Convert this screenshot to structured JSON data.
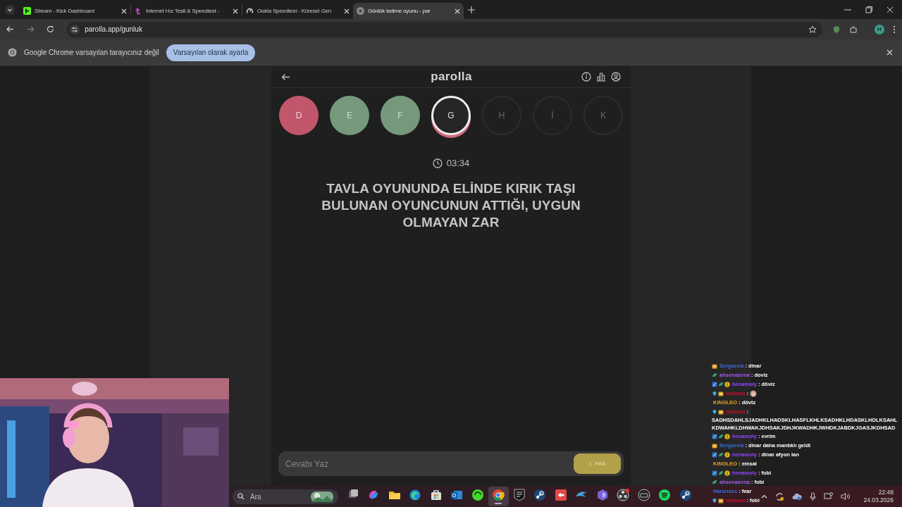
{
  "browser": {
    "tabs": [
      {
        "title": "Stream - Kick Dashboard",
        "selected": false,
        "kind": "square"
      },
      {
        "title": "İnternet Hız Testi & Speedtest -",
        "selected": false,
        "kind": "letter"
      },
      {
        "title": "Ookla Speedtest - Küresel Gen",
        "selected": false,
        "kind": "gauge"
      },
      {
        "title": "Günlük kelime oyunu - par",
        "selected": true,
        "kind": "circle"
      }
    ],
    "address": "parolla.app/gunluk",
    "profile_initial": "H",
    "infobar": {
      "message": "Google Chrome varsayılan tarayıcınız değil",
      "button": "Varsayılan olarak ayarla"
    }
  },
  "game": {
    "logo": "parolla",
    "letters": [
      {
        "letter": "D",
        "kind": "wrong"
      },
      {
        "letter": "E",
        "kind": "correct"
      },
      {
        "letter": "F",
        "kind": "correct"
      },
      {
        "letter": "G",
        "kind": "current"
      },
      {
        "letter": "H",
        "kind": "pending"
      },
      {
        "letter": "İ",
        "kind": "pending"
      },
      {
        "letter": "K",
        "kind": "pending"
      }
    ],
    "timer": "03:34",
    "question": "TAVLA OYUNUNDA ELİNDE KIRIK TAŞI BULUNAN OYUNCUNUN ATTIĞI, UYGUN OLMAYAN ZAR",
    "answer_placeholder": "Cevabı Yaz",
    "pass_button": "PAS"
  },
  "chat": [
    {
      "badges": [
        {
          "kind": "crown"
        }
      ],
      "user": "Sergoreis",
      "color": "#3b6fd8",
      "separator": ":",
      "text": "dinar",
      "kind": "text"
    },
    {
      "badges": [
        {
          "kind": "leaf"
        }
      ],
      "user": "ahsenasena",
      "color": "#a855f7",
      "separator": ":",
      "text": "doviz",
      "kind": "text"
    },
    {
      "badges": [
        {
          "kind": "box"
        },
        {
          "kind": "leaf"
        },
        {
          "kind": "coin"
        }
      ],
      "user": "henamoly",
      "color": "#9146ff",
      "separator": ":",
      "text": "döviz",
      "kind": "text"
    },
    {
      "badges": [
        {
          "kind": "gem"
        },
        {
          "kind": "crown"
        }
      ],
      "user": "tazkaan",
      "color": "#c8102e",
      "separator": ":",
      "kind": "emote"
    },
    {
      "user": "KINGLEO",
      "color": "#e8a020",
      "separator": ":",
      "text": "dövtz",
      "kind": "text"
    },
    {
      "badges": [
        {
          "kind": "gem"
        },
        {
          "kind": "crown"
        }
      ],
      "user": "tazkaan",
      "color": "#c8102e",
      "separator": ":",
      "text": "SADHSDAHLSJADHKLHADSKLHASFLKHLKSADHKLHDASKLHDLKSAHLKDWAHKLDHWAKJDHSAKJDHJKWADHKJWHDKJABDKJGASJKDHSAD",
      "kind": "long"
    },
    {
      "badges": [
        {
          "kind": "box"
        },
        {
          "kind": "leaf"
        },
        {
          "kind": "coin"
        }
      ],
      "user": "henamoly",
      "color": "#9146ff",
      "separator": ":",
      "text": "evrim",
      "kind": "text"
    },
    {
      "badges": [
        {
          "kind": "crown"
        }
      ],
      "user": "Sergoreis",
      "color": "#3b6fd8",
      "separator": ":",
      "text": "dinar daha mantıklı geldi",
      "kind": "text"
    },
    {
      "badges": [
        {
          "kind": "box"
        },
        {
          "kind": "leaf"
        },
        {
          "kind": "coin"
        }
      ],
      "user": "henamoly",
      "color": "#9146ff",
      "separator": ":",
      "text": "dinar afyon lan",
      "kind": "text"
    },
    {
      "user": "KINGLEO",
      "color": "#e8a020",
      "separator": ":",
      "text": "emsal",
      "kind": "text"
    },
    {
      "badges": [
        {
          "kind": "box"
        },
        {
          "kind": "leaf"
        },
        {
          "kind": "coin"
        }
      ],
      "user": "henamoly",
      "color": "#9146ff",
      "separator": ":",
      "text": "fobi",
      "kind": "text"
    },
    {
      "badges": [
        {
          "kind": "leaf"
        }
      ],
      "user": "ahsenasena",
      "color": "#a855f7",
      "separator": ":",
      "text": "fobi",
      "kind": "text"
    },
    {
      "user": "Harunsss",
      "color": "#3b6fd8",
      "separator": ":",
      "text": "fear",
      "kind": "text"
    },
    {
      "badges": [
        {
          "kind": "gem"
        },
        {
          "kind": "crown"
        }
      ],
      "user": "tazkaan",
      "color": "#c8102e",
      "separator": ":",
      "text": "fobi",
      "kind": "text"
    }
  ],
  "taskbar": {
    "search_placeholder": "Ara",
    "apps": [
      {
        "kind": "taskview",
        "active": false
      },
      {
        "kind": "copilot",
        "active": false
      },
      {
        "kind": "folder",
        "active": false
      },
      {
        "kind": "edge",
        "active": false
      },
      {
        "kind": "store",
        "active": false
      },
      {
        "kind": "mail",
        "active": false
      },
      {
        "kind": "snake",
        "active": false
      },
      {
        "kind": "chrome",
        "active": true
      },
      {
        "kind": "epic",
        "active": false
      },
      {
        "kind": "steam",
        "active": false
      },
      {
        "kind": "remote",
        "active": false
      },
      {
        "kind": "dolphin",
        "active": false
      },
      {
        "kind": "hex",
        "active": false
      },
      {
        "kind": "obs",
        "active": false
      },
      {
        "kind": "keyboard",
        "active": false
      },
      {
        "kind": "spotify",
        "active": false
      },
      {
        "kind": "steam",
        "active": false
      }
    ],
    "time": "22:48",
    "date": "24.03.2026"
  }
}
